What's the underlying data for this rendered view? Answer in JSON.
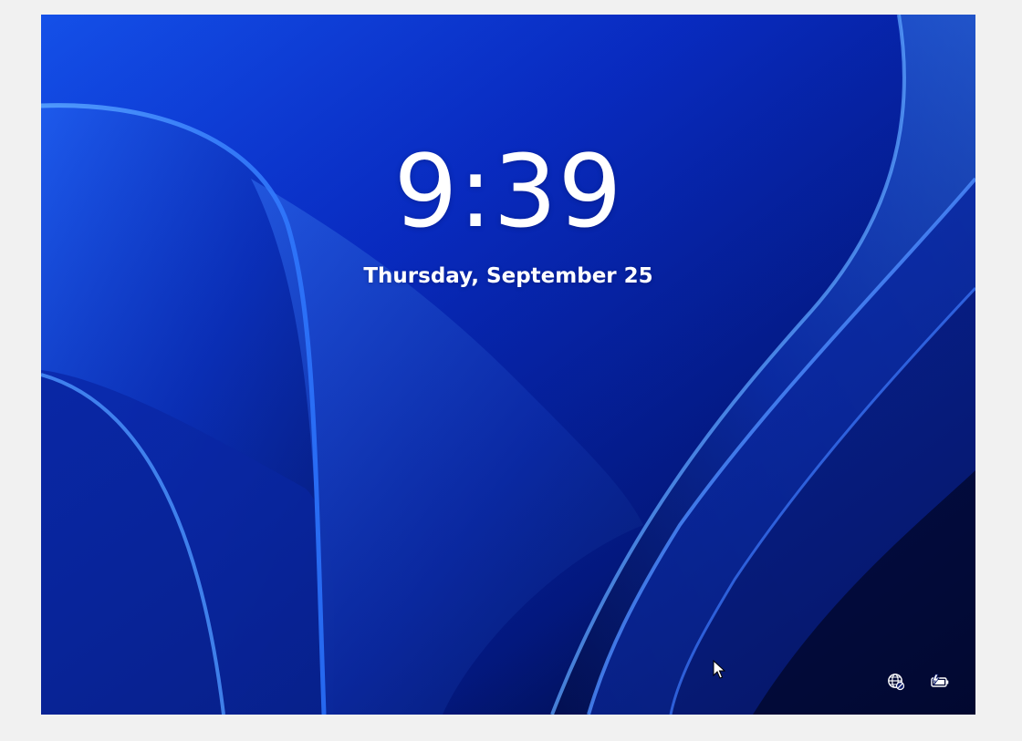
{
  "lock_screen": {
    "time": "9:39",
    "date": "Thursday, September 25"
  },
  "tray": {
    "network_icon": "network-globe-icon",
    "power_icon": "battery-charging-icon"
  },
  "colors": {
    "page_background": "#f1f1f1",
    "wallpaper_primary": "#0a2fd0",
    "wallpaper_dark": "#020a3a",
    "text": "#ffffff"
  }
}
